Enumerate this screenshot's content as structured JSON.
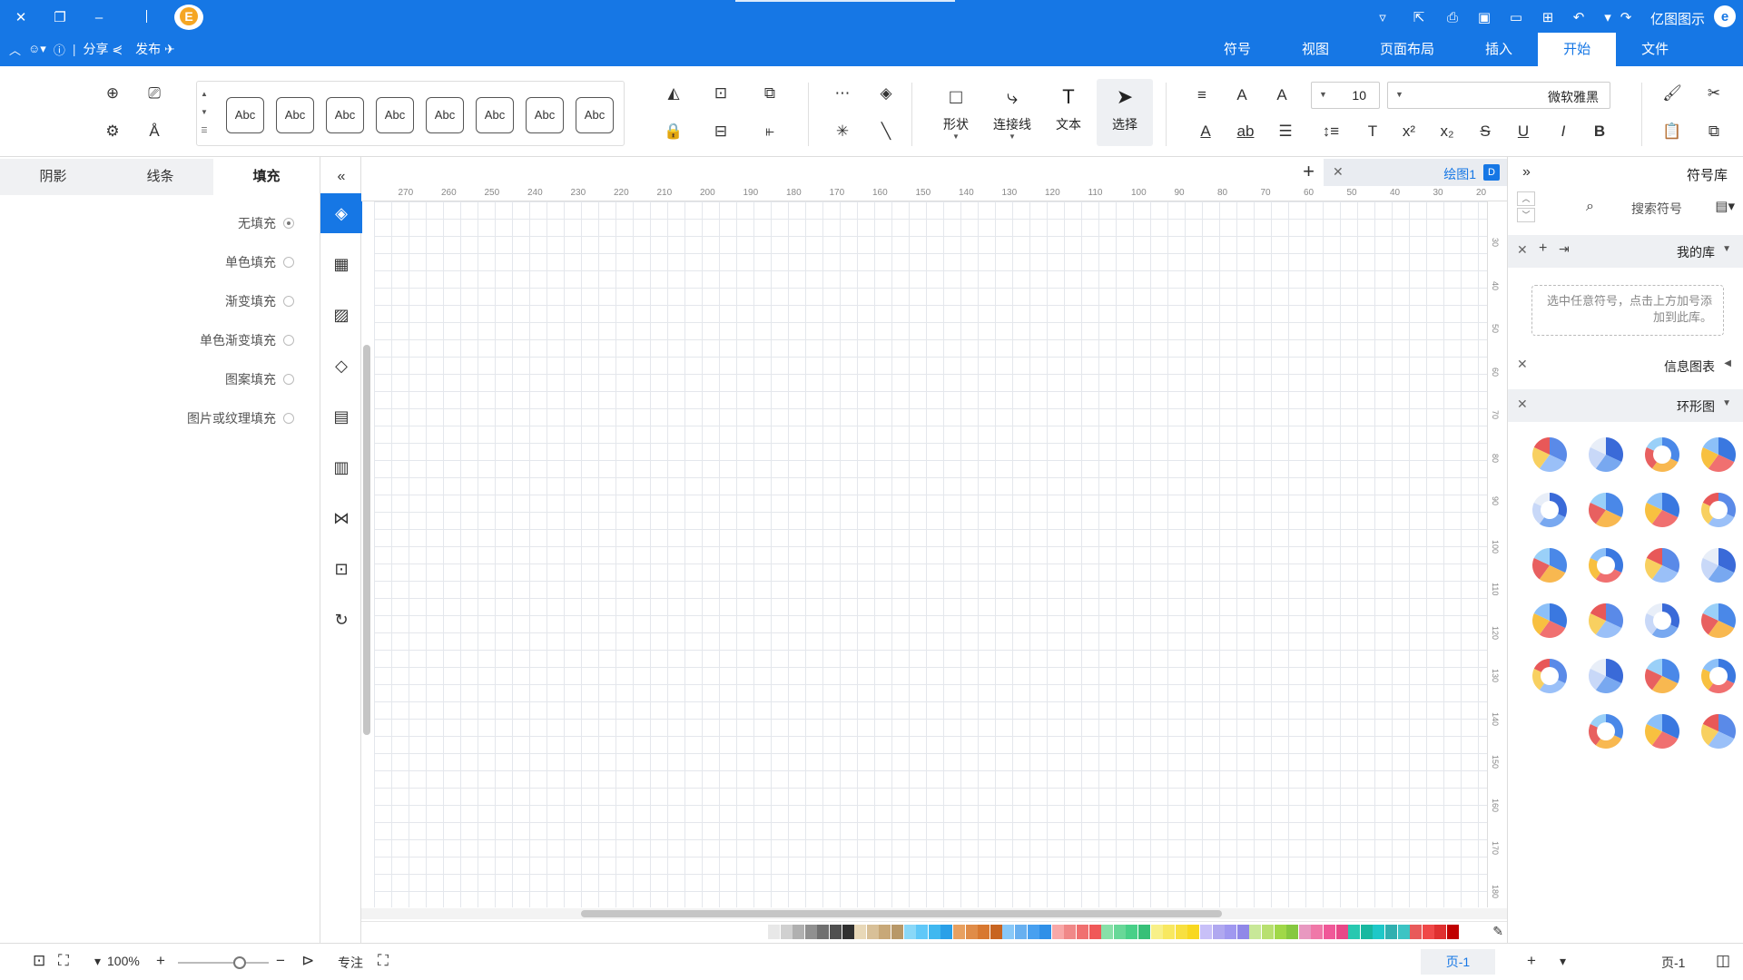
{
  "app": {
    "name": "亿图图示",
    "badge_letter": "E"
  },
  "titlebar": {
    "share_label": "分享",
    "publish_label": "发布",
    "window_controls": [
      "close-icon",
      "restore-icon",
      "minimize-icon"
    ],
    "quick_icons": [
      "redo-icon",
      "undo-icon",
      "new-icon",
      "open-icon",
      "save-icon",
      "print-icon",
      "export-icon",
      "more-icon"
    ]
  },
  "menu_tabs": [
    {
      "label": "文件",
      "active": false
    },
    {
      "label": "开始",
      "active": true
    },
    {
      "label": "插入",
      "active": false
    },
    {
      "label": "页面布局",
      "active": false
    },
    {
      "label": "视图",
      "active": false
    },
    {
      "label": "符号",
      "active": false
    }
  ],
  "ribbon": {
    "font_family": "微软雅黑",
    "font_size": "10",
    "tools": [
      {
        "label": "选择",
        "icon": "pointer-icon",
        "active": true
      },
      {
        "label": "文本",
        "icon": "text-icon",
        "active": false
      },
      {
        "label": "连接线",
        "icon": "connector-icon",
        "active": false
      },
      {
        "label": "形状",
        "icon": "shape-icon",
        "active": false
      }
    ],
    "style_swatches": [
      "Abc",
      "Abc",
      "Abc",
      "Abc",
      "Abc",
      "Abc",
      "Abc",
      "Abc"
    ]
  },
  "library": {
    "title": "符号库",
    "search_placeholder": "搜索符号",
    "sections": [
      {
        "name": "我的库",
        "expanded": true
      },
      {
        "name": "信息图表",
        "expanded": false
      },
      {
        "name": "环形图",
        "expanded": true
      }
    ],
    "my_library_hint": "选中任意符号，点击上方加号添加到此库。"
  },
  "document": {
    "tab_name": "绘图1",
    "page_name": "页-1",
    "page_tab": "页-1"
  },
  "ruler": {
    "top_ticks": [
      "20",
      "30",
      "40",
      "50",
      "60",
      "70",
      "80",
      "90",
      "100",
      "110",
      "120",
      "130",
      "140",
      "150",
      "160",
      "170",
      "180",
      "190",
      "200",
      "210",
      "220",
      "230",
      "240",
      "250",
      "260",
      "270"
    ],
    "side_ticks": [
      "30",
      "40",
      "50",
      "60",
      "70",
      "80",
      "90",
      "100",
      "110",
      "120",
      "130",
      "140",
      "150",
      "160",
      "170",
      "180"
    ]
  },
  "property_panel": {
    "tabs": [
      {
        "label": "填充",
        "active": true
      },
      {
        "label": "线条",
        "active": false
      },
      {
        "label": "阴影",
        "active": false
      }
    ],
    "fill_options": [
      {
        "label": "无填充",
        "selected": true
      },
      {
        "label": "单色填充",
        "selected": false
      },
      {
        "label": "渐变填充",
        "selected": false
      },
      {
        "label": "单色渐变填充",
        "selected": false
      },
      {
        "label": "图案填充",
        "selected": false
      },
      {
        "label": "图片或纹理填充",
        "selected": false
      }
    ]
  },
  "statusbar": {
    "focus_label": "专注",
    "zoom": "100%",
    "zoom_level": 0.68
  },
  "colors": {
    "brand": "#1677e5",
    "palette": [
      "#c00000",
      "#e03030",
      "#f04848",
      "#e85a5a",
      "#3cc4c4",
      "#30b0b0",
      "#1ec8c8",
      "#18b8a0",
      "#28c8b0",
      "#e84888",
      "#f05898",
      "#f078a8",
      "#e898c0",
      "#86c840",
      "#a0d848",
      "#b8e070",
      "#c8e898",
      "#9088e8",
      "#a098f0",
      "#b0a8f0",
      "#c8c0f8",
      "#f8d820",
      "#f8e040",
      "#f8e860",
      "#f8f088",
      "#38c078",
      "#48d088",
      "#68d898",
      "#88e0a8",
      "#f05858",
      "#f07070",
      "#f08888",
      "#f8a8a8",
      "#3090e8",
      "#48a0f0",
      "#68b0f0",
      "#88c8f8",
      "#c86420",
      "#d87830",
      "#e08c48",
      "#e8a060",
      "#2aa0e8",
      "#40b8f0",
      "#60c8f8",
      "#8ad8f8",
      "#b89868",
      "#c8a878",
      "#d8c098",
      "#e8d8b8",
      "#303030",
      "#505050",
      "#707070",
      "#909090",
      "#b0b0b0",
      "#d0d0d0",
      "#e8e8e8"
    ]
  }
}
